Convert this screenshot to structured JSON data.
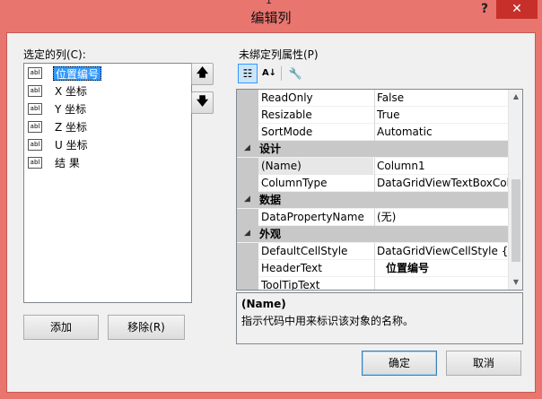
{
  "window": {
    "title": "编辑列",
    "help_glyph": "?",
    "close_glyph": "✕",
    "top_glyph": "1"
  },
  "left": {
    "list_label": "选定的列(C):",
    "columns": [
      {
        "icon_text": "abl",
        "label": "位置编号",
        "selected": true
      },
      {
        "icon_text": "abl",
        "label": "X 坐标",
        "selected": false
      },
      {
        "icon_text": "abl",
        "label": "Y 坐标",
        "selected": false
      },
      {
        "icon_text": "abl",
        "label": "Z 坐标",
        "selected": false
      },
      {
        "icon_text": "abl",
        "label": "U 坐标",
        "selected": false
      },
      {
        "icon_text": "abl",
        "label": "结 果",
        "selected": false
      }
    ],
    "move_up_glyph": "🡅",
    "move_down_glyph": "🡇",
    "add_label": "添加",
    "remove_label": "移除(R)"
  },
  "right": {
    "grid_label": "未绑定列属性(P)",
    "toolbar": {
      "categorized_glyph": "☷",
      "alphabetical_glyph": "A↓",
      "property_pages_glyph": "🔧"
    },
    "rows": [
      {
        "type": "prop",
        "name": "ReadOnly",
        "value": "False"
      },
      {
        "type": "prop",
        "name": "Resizable",
        "value": "True"
      },
      {
        "type": "prop",
        "name": "SortMode",
        "value": "Automatic"
      },
      {
        "type": "cat",
        "name": "设计",
        "value": ""
      },
      {
        "type": "prop",
        "name": "(Name)",
        "value": "Column1",
        "selected": true
      },
      {
        "type": "prop",
        "name": "ColumnType",
        "value": "DataGridViewTextBoxColu"
      },
      {
        "type": "cat",
        "name": "数据",
        "value": ""
      },
      {
        "type": "prop",
        "name": "DataPropertyName",
        "value": "(无)"
      },
      {
        "type": "cat",
        "name": "外观",
        "value": ""
      },
      {
        "type": "prop",
        "name": "DefaultCellStyle",
        "value": "DataGridViewCellStyle { }"
      },
      {
        "type": "prop",
        "name": "HeaderText",
        "value": "位置编号",
        "bold": true
      },
      {
        "type": "prop",
        "name": "ToolTipText",
        "value": ""
      }
    ],
    "collapse_glyph": "◢",
    "scroll_up_glyph": "▲",
    "scroll_down_glyph": "▼",
    "description": {
      "title": "(Name)",
      "text": "指示代码中用来标识该对象的名称。"
    }
  },
  "footer": {
    "ok_label": "确定",
    "cancel_label": "取消"
  },
  "colors": {
    "title_bar": "#e9756f",
    "close_button": "#c7302a",
    "selection": "#3399ff"
  }
}
